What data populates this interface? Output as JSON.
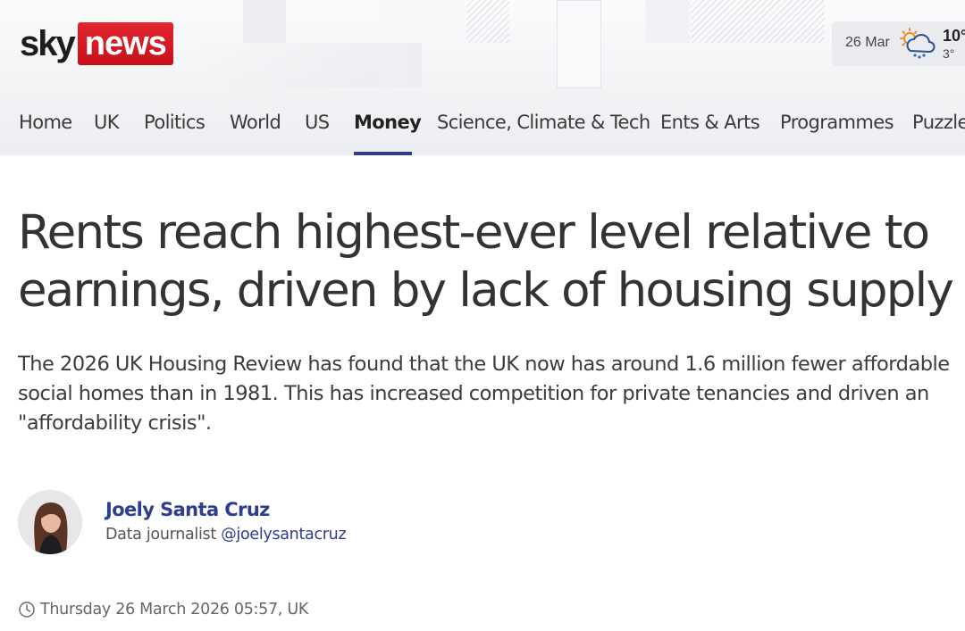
{
  "brand": {
    "logo_sky": "sky",
    "logo_news": "news",
    "accent": "#2f3d8f",
    "logo_red": "#d71920"
  },
  "weather": {
    "date": "26 Mar",
    "high": "10°",
    "low": "3°",
    "icon": "partly-cloudy-sleet-icon"
  },
  "nav": {
    "items": [
      {
        "label": "Home"
      },
      {
        "label": "UK"
      },
      {
        "label": "Politics"
      },
      {
        "label": "World"
      },
      {
        "label": "US"
      },
      {
        "label": "Money",
        "active": true
      },
      {
        "label": "Science, Climate & Tech"
      },
      {
        "label": "Ents & Arts"
      },
      {
        "label": "Programmes"
      },
      {
        "label": "Puzzles"
      }
    ]
  },
  "article": {
    "headline": "Rents reach highest-ever level relative to earnings, driven by lack of housing supply",
    "standfirst": "The 2026 UK Housing Review has found that the UK now has around 1.6 million fewer affordable social homes than in 1981. This has increased competition for private tenancies and driven an \"affordability crisis\".",
    "author": {
      "name": "Joely Santa Cruz",
      "role": "Data journalist",
      "handle": "@joelysantacruz"
    },
    "timestamp": "Thursday 26 March 2026 05:57, UK"
  }
}
